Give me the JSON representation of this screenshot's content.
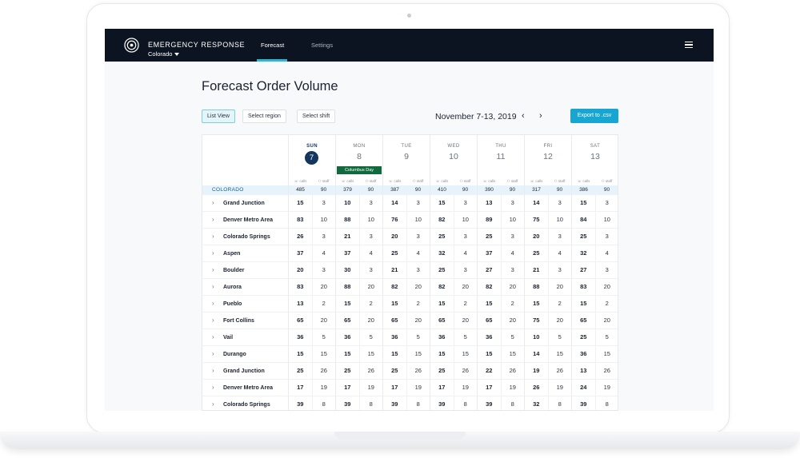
{
  "header": {
    "app_title": "EMERGENCY RESPONSE",
    "region": "Colorado",
    "tabs": [
      "Forecast",
      "Settings"
    ]
  },
  "page": {
    "title": "Forecast Order Volume",
    "buttons": {
      "list_view": "List View",
      "select_region": "Select region",
      "select_shift": "Select shift",
      "export": "Export to .csv"
    },
    "date_range": "November 7-13, 2019"
  },
  "columns": {
    "calls": "calls",
    "staff": "staff"
  },
  "days": [
    {
      "name": "SUN",
      "num": "7",
      "active": true,
      "holiday": ""
    },
    {
      "name": "MON",
      "num": "8",
      "active": false,
      "holiday": "Columbus Day"
    },
    {
      "name": "TUE",
      "num": "9",
      "active": false,
      "holiday": ""
    },
    {
      "name": "WED",
      "num": "10",
      "active": false,
      "holiday": ""
    },
    {
      "name": "THU",
      "num": "11",
      "active": false,
      "holiday": ""
    },
    {
      "name": "FRI",
      "num": "12",
      "active": false,
      "holiday": ""
    },
    {
      "name": "SAT",
      "num": "13",
      "active": false,
      "holiday": ""
    }
  ],
  "summary": {
    "label": "COLORADO",
    "values": [
      [
        "485",
        "90"
      ],
      [
        "379",
        "90"
      ],
      [
        "387",
        "90"
      ],
      [
        "410",
        "90"
      ],
      [
        "390",
        "90"
      ],
      [
        "317",
        "90"
      ],
      [
        "386",
        "90"
      ]
    ]
  },
  "rows": [
    {
      "label": "Grand Junction",
      "values": [
        [
          "15",
          "3"
        ],
        [
          "10",
          "3"
        ],
        [
          "14",
          "3"
        ],
        [
          "15",
          "3"
        ],
        [
          "13",
          "3"
        ],
        [
          "14",
          "3"
        ],
        [
          "15",
          "3"
        ]
      ]
    },
    {
      "label": "Denver Metro Area",
      "values": [
        [
          "83",
          "10"
        ],
        [
          "88",
          "10"
        ],
        [
          "76",
          "10"
        ],
        [
          "82",
          "10"
        ],
        [
          "89",
          "10"
        ],
        [
          "75",
          "10"
        ],
        [
          "84",
          "10"
        ]
      ]
    },
    {
      "label": "Colorado Springs",
      "values": [
        [
          "26",
          "3"
        ],
        [
          "21",
          "3"
        ],
        [
          "20",
          "3"
        ],
        [
          "25",
          "3"
        ],
        [
          "25",
          "3"
        ],
        [
          "20",
          "3"
        ],
        [
          "25",
          "3"
        ]
      ]
    },
    {
      "label": "Aspen",
      "values": [
        [
          "37",
          "4"
        ],
        [
          "37",
          "4"
        ],
        [
          "25",
          "4"
        ],
        [
          "32",
          "4"
        ],
        [
          "37",
          "4"
        ],
        [
          "25",
          "4"
        ],
        [
          "32",
          "4"
        ]
      ]
    },
    {
      "label": "Boulder",
      "values": [
        [
          "20",
          "3"
        ],
        [
          "30",
          "3"
        ],
        [
          "21",
          "3"
        ],
        [
          "25",
          "3"
        ],
        [
          "27",
          "3"
        ],
        [
          "21",
          "3"
        ],
        [
          "27",
          "3"
        ]
      ]
    },
    {
      "label": "Aurora",
      "values": [
        [
          "83",
          "20"
        ],
        [
          "88",
          "20"
        ],
        [
          "82",
          "20"
        ],
        [
          "82",
          "20"
        ],
        [
          "82",
          "20"
        ],
        [
          "88",
          "20"
        ],
        [
          "83",
          "20"
        ]
      ]
    },
    {
      "label": "Pueblo",
      "values": [
        [
          "13",
          "2"
        ],
        [
          "15",
          "2"
        ],
        [
          "15",
          "2"
        ],
        [
          "15",
          "2"
        ],
        [
          "15",
          "2"
        ],
        [
          "15",
          "2"
        ],
        [
          "15",
          "2"
        ]
      ]
    },
    {
      "label": "Fort Collins",
      "values": [
        [
          "65",
          "20"
        ],
        [
          "65",
          "20"
        ],
        [
          "65",
          "20"
        ],
        [
          "65",
          "20"
        ],
        [
          "65",
          "20"
        ],
        [
          "75",
          "20"
        ],
        [
          "65",
          "20"
        ]
      ]
    },
    {
      "label": "Vail",
      "values": [
        [
          "36",
          "5"
        ],
        [
          "36",
          "5"
        ],
        [
          "36",
          "5"
        ],
        [
          "36",
          "5"
        ],
        [
          "36",
          "5"
        ],
        [
          "10",
          "5"
        ],
        [
          "25",
          "5"
        ]
      ]
    },
    {
      "label": "Durango",
      "values": [
        [
          "15",
          "15"
        ],
        [
          "15",
          "15"
        ],
        [
          "15",
          "15"
        ],
        [
          "15",
          "15"
        ],
        [
          "15",
          "15"
        ],
        [
          "14",
          "15"
        ],
        [
          "36",
          "15"
        ]
      ]
    },
    {
      "label": "Grand Junction",
      "values": [
        [
          "25",
          "26"
        ],
        [
          "25",
          "26"
        ],
        [
          "25",
          "26"
        ],
        [
          "25",
          "26"
        ],
        [
          "22",
          "26"
        ],
        [
          "19",
          "26"
        ],
        [
          "13",
          "26"
        ]
      ]
    },
    {
      "label": "Denver Metro Area",
      "values": [
        [
          "17",
          "19"
        ],
        [
          "17",
          "19"
        ],
        [
          "17",
          "19"
        ],
        [
          "17",
          "19"
        ],
        [
          "17",
          "19"
        ],
        [
          "26",
          "19"
        ],
        [
          "24",
          "19"
        ]
      ]
    },
    {
      "label": "Colorado Springs",
      "values": [
        [
          "39",
          "8"
        ],
        [
          "39",
          "8"
        ],
        [
          "39",
          "8"
        ],
        [
          "39",
          "8"
        ],
        [
          "39",
          "8"
        ],
        [
          "32",
          "8"
        ],
        [
          "39",
          "8"
        ]
      ]
    }
  ]
}
